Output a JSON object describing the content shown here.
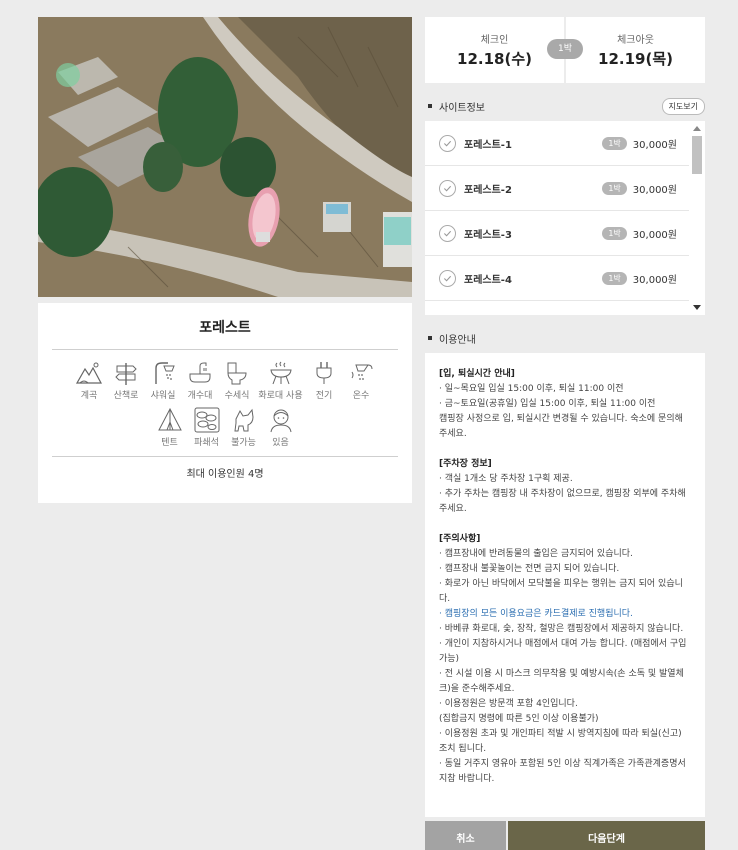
{
  "site": {
    "title": "포레스트",
    "max_people": "최대 이용인원 4명"
  },
  "amenities": [
    {
      "label": "계곡",
      "icon": "valley-icon"
    },
    {
      "label": "산책로",
      "icon": "trail-sign-icon"
    },
    {
      "label": "샤워실",
      "icon": "shower-icon"
    },
    {
      "label": "개수대",
      "icon": "sink-icon"
    },
    {
      "label": "수세식",
      "icon": "toilet-icon"
    },
    {
      "label": "화로대 사용",
      "icon": "grill-icon"
    },
    {
      "label": "전기",
      "icon": "plug-icon"
    },
    {
      "label": "온수",
      "icon": "hot-water-icon"
    },
    {
      "label": "텐트",
      "icon": "tent-icon"
    },
    {
      "label": "파쇄석",
      "icon": "gravel-icon"
    },
    {
      "label": "불가능",
      "icon": "no-pet-icon"
    },
    {
      "label": "있음",
      "icon": "staff-icon"
    }
  ],
  "dates": {
    "checkin_label": "체크인",
    "checkin_value": "12.18(수)",
    "checkout_label": "체크아웃",
    "checkout_value": "12.19(목)",
    "nights": "1박"
  },
  "site_info": {
    "title": "사이트정보",
    "map_button": "지도보기",
    "items": [
      {
        "name": "포레스트-1",
        "nights": "1박",
        "price": "30,000원"
      },
      {
        "name": "포레스트-2",
        "nights": "1박",
        "price": "30,000원"
      },
      {
        "name": "포레스트-3",
        "nights": "1박",
        "price": "30,000원"
      },
      {
        "name": "포레스트-4",
        "nights": "1박",
        "price": "30,000원"
      }
    ]
  },
  "guide": {
    "title": "이용안내",
    "s1_title": "[입, 퇴실시간 안내]",
    "s1_l1": "· 일~목요일 입실 15:00 이후, 퇴실 11:00 이전",
    "s1_l2": "· 금~토요일(공휴일) 입실 15:00 이후, 퇴실 11:00 이전",
    "s1_l3": "캠핑장 사정으로 입, 퇴실시간 변경될 수 있습니다. 숙소에 문의해 주세요.",
    "s2_title": "[주차장 정보]",
    "s2_l1": "· 객실 1개소 당 주차장 1구획 제공.",
    "s2_l2": "· 추가 주차는 캠핑장 내 주차장이 없으므로, 캠핑장 외부에 주차해주세요.",
    "s3_title": "[주의사항]",
    "s3_l1": "· 캠프장내에 반려동물의 출입은 금지되어 있습니다.",
    "s3_l2": "· 캠프장내 불꽃놀이는 전면 금지 되어 있습니다.",
    "s3_l3": "· 화로가 아닌 바닥에서 모닥불을 피우는 행위는 금지 되어 있습니다.",
    "s3_l4": "· 캠핑장의 모든 이용요금은 카드결제로 진행됩니다.",
    "s3_l5": "· 바베큐 화로대, 숯, 장작, 철망은 캠핑장에서 제공하지 않습니다.",
    "s3_l6": "· 개인이 지참하시거나 매점에서 대여 가능 합니다. (매점에서 구입가능)",
    "s3_l7": "· 전 시설 이용 시 마스크 의무착용 및 예방시속(손 소독 및 발열체크)을 준수해주세요.",
    "s3_l8": "· 이용정원은 방문객 포함 4인입니다.",
    "s3_l9": "(집합금지 명령에 따른 5인 이상 이용불가)",
    "s3_l10": "· 이용정원 초과 및 개인파티 적발 시 방역지침에 따라 퇴실(신고) 조치 됩니다.",
    "s3_l11": "· 동일 거주지 영유아 포함된 5인 이상 직계가족은 가족관계증명서 지참 바랍니다."
  },
  "buttons": {
    "cancel": "취소",
    "next": "다음단계"
  },
  "colors": {
    "next_button": "#6a6649",
    "cancel_button": "#a3a3a3",
    "notice_blue": "#2a6db0",
    "page_bg": "#ececec"
  }
}
